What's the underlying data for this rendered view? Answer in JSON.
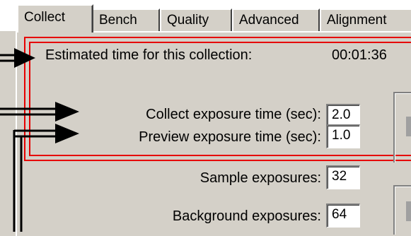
{
  "tabs": [
    {
      "label": "Collect",
      "active": true
    },
    {
      "label": "Bench",
      "active": false
    },
    {
      "label": "Quality",
      "active": false
    },
    {
      "label": "Advanced",
      "active": false
    },
    {
      "label": "Alignment",
      "active": false
    }
  ],
  "estimated_time": {
    "label": "Estimated time for this collection:",
    "value": "00:01:36"
  },
  "collect_exposure": {
    "label": "Collect exposure time (sec):",
    "value": "2.0"
  },
  "preview_exposure": {
    "label": "Preview exposure time (sec):",
    "value": "1.0"
  },
  "sample_exposures": {
    "label": "Sample exposures:",
    "value": "32"
  },
  "background_exposures": {
    "label": "Background exposures:",
    "value": "64"
  },
  "colors": {
    "highlight": "#e60000",
    "face": "#d4d0c8",
    "arrow": "#000000"
  }
}
